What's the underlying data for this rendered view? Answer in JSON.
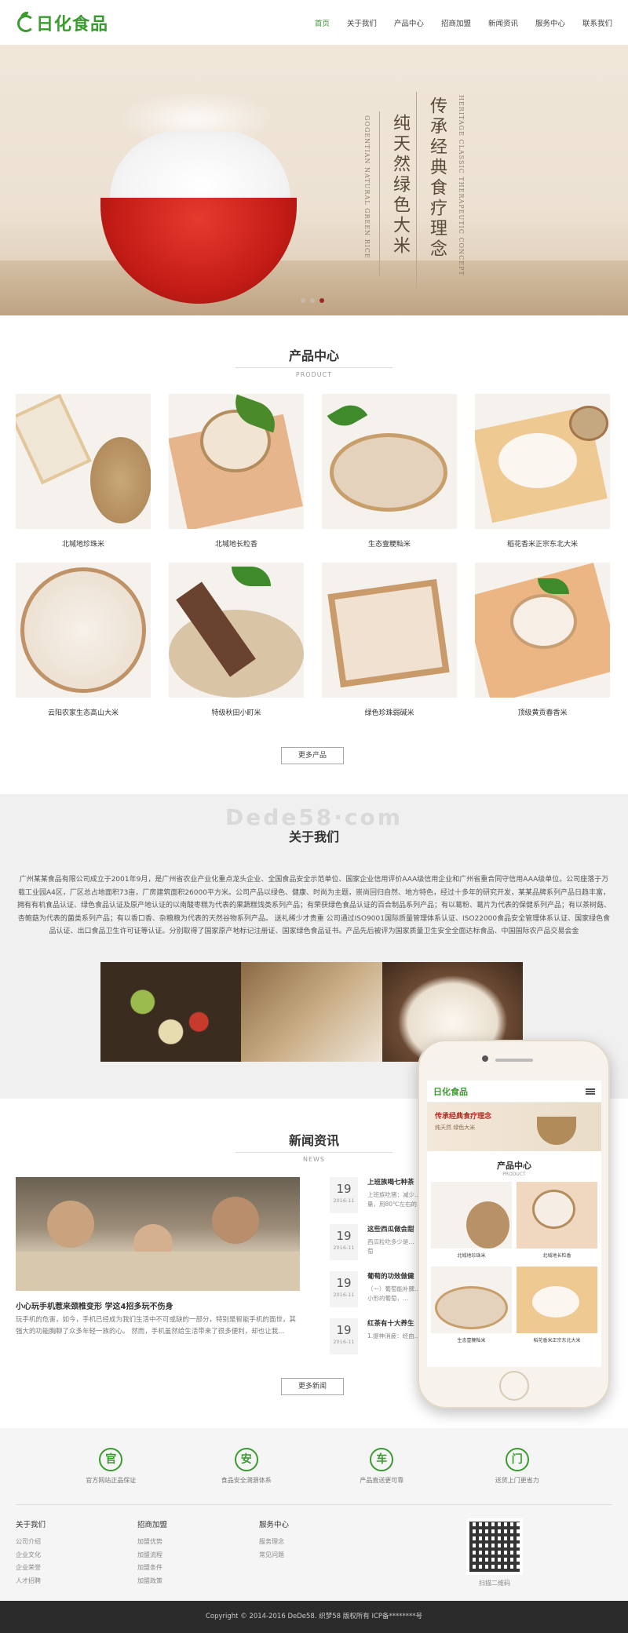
{
  "header": {
    "logo_text": "日化食品",
    "nav": [
      "首页",
      "关于我们",
      "产品中心",
      "招商加盟",
      "新闻资讯",
      "服务中心",
      "联系我们"
    ]
  },
  "banner": {
    "line1": "传承经典食疗理念",
    "line2": "纯天然绿色大米",
    "en1": "HERITAGE CLASSIC THERAPEUTIC CONCEPT",
    "en2": "GOGENTIAN NATURAL GREEN RICE"
  },
  "products": {
    "title": "产品中心",
    "subtitle": "PRODUCT",
    "items": [
      "北堿地珍珠米",
      "北堿地长粒香",
      "生态壹粳籼米",
      "稻花香米正宗东北大米",
      "云阳农家生态高山大米",
      "特级秋田小町米",
      "绿色珍珠弱碱米",
      "顶级黄贡春香米"
    ],
    "more_label": "更多产品"
  },
  "about": {
    "watermark": "Dede58·com",
    "title": "关于我们",
    "text": "广州某某食品有限公司成立于2001年9月，是广州省农业产业化重点龙头企业、全国食品安全示范单位、国家企业信用评价AAA级信用企业和广州省重合同守信用AAA级单位。公司座落于万载工业园A4区，厂区总占地面积73亩，厂房建筑面积26000平方米。公司产品以绿色、健康、时尚为主题，崇尚回归自然、地方特色，经过十多年的研究开发，某某品牌系列产品日趋丰富，拥有有机食品认证、绿色食品认证及原产地认证的以南酸枣糕为代表的果蔬糕饯类系列产品；有荣获绿色食品认证的百合制品系列产品；有以葛粉、葛片为代表的保健系列产品；有以茶树菇、杏鲍菇为代表的菌类系列产品；有以香口香、杂粮粮为代表的天然谷物系列产品。 送礼稀少才贵重 公司通过ISO9001国际质量管理体系认证、ISO22000食品安全管理体系认证、国家绿色食品认证、出口食品卫生许可证等认证。分别取得了国家原产地标记注册证、国家绿色食品证书。产品先后被评为国家质量卫生安全全面达标食品、中国国际农产品交易会金"
  },
  "news": {
    "title": "新闻资讯",
    "subtitle": "NEWS",
    "main_title": "小心玩手机惹来颈椎变形 学这4招多玩不伤身",
    "main_summary": "玩手机的危害，如今，手机已经成为我们生活中不可或缺的一部分，特别是智能手机的面世，其强大的功能胸聊了众多年轻一族的心。 然而，手机虽然给生活带来了很多便利，却也让我...",
    "items": [
      {
        "day": "19",
        "ym": "2016-11",
        "title": "上班族喝七种茶",
        "summary": "上班族吃猪：减少..."
      },
      {
        "day": "19",
        "ym": "2016-11",
        "title": "这些西瓜做会甜",
        "summary": "西瓜粒吃多少是..."
      },
      {
        "day": "19",
        "ym": "2016-11",
        "title": "葡萄的功效做健",
        "summary": "（一）葡萄能补脾..."
      },
      {
        "day": "19",
        "ym": "2016-11",
        "title": "红茶有十大养生",
        "summary": "1.提神消疲：经由..."
      }
    ],
    "news_summary_extra": [
      "量，用80℃左右的...",
      "萄",
      "小形的葡萄，..."
    ],
    "more_label": "更多新闻"
  },
  "phone": {
    "logo": "日化食品",
    "banner_line1": "传承经典食疗理念",
    "banner_line2": "纯天然  绿色大米",
    "section_title": "产品中心",
    "section_sub": "PRODUCT",
    "items": [
      "北堿地珍珠米",
      "北堿地长粒香",
      "生态壹粳籼米",
      "稻花香米正宗东北大米"
    ]
  },
  "features": [
    {
      "icon": "官",
      "label": "官方网站正品保证"
    },
    {
      "icon": "安",
      "label": "食品安全溯源体系"
    },
    {
      "icon": "车",
      "label": "产品直送更可靠"
    },
    {
      "icon": "门",
      "label": "送货上门更省力"
    }
  ],
  "footer_cols": [
    {
      "heading": "关于我们",
      "items": [
        "公司介绍",
        "企业文化",
        "企业荣誉",
        "人才招聘"
      ]
    },
    {
      "heading": "招商加盟",
      "items": [
        "加盟优势",
        "加盟流程",
        "加盟条件",
        "加盟政策"
      ]
    },
    {
      "heading": "服务中心",
      "items": [
        "服务理念",
        "常见问题"
      ]
    }
  ],
  "qr_label": "扫描二维码",
  "copyright": "Copyright © 2014-2016 DeDe58. 织梦58 版权所有    ICP备********号",
  "colors": {
    "brand": "#3a9b2f",
    "footer": "#2b2b2b"
  }
}
